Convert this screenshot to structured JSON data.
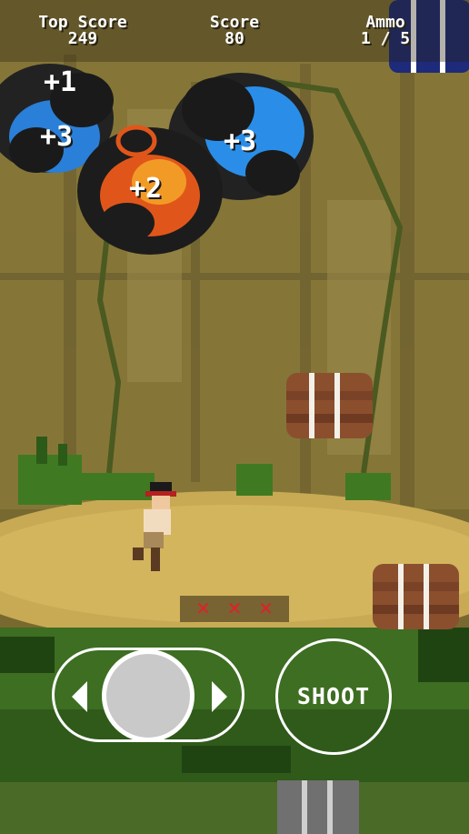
{
  "hud": {
    "top_score_label": "Top Score",
    "top_score_value": "249",
    "score_label": "Score",
    "score_value": "80",
    "ammo_label": "Ammo",
    "ammo_value": "1 / 5"
  },
  "popups": [
    "+1",
    "+3",
    "+3",
    "+2"
  ],
  "lives": {
    "marks": [
      "✕",
      "✕",
      "✕"
    ],
    "color": "#e0202a"
  },
  "controls": {
    "shoot_label": "SHOOT"
  },
  "colors": {
    "sky_dark": "#3b3420",
    "wall": "#8a7a3c",
    "ground": "#c9aa55",
    "grass": "#3d6e22",
    "barrel": "#8a5030"
  }
}
